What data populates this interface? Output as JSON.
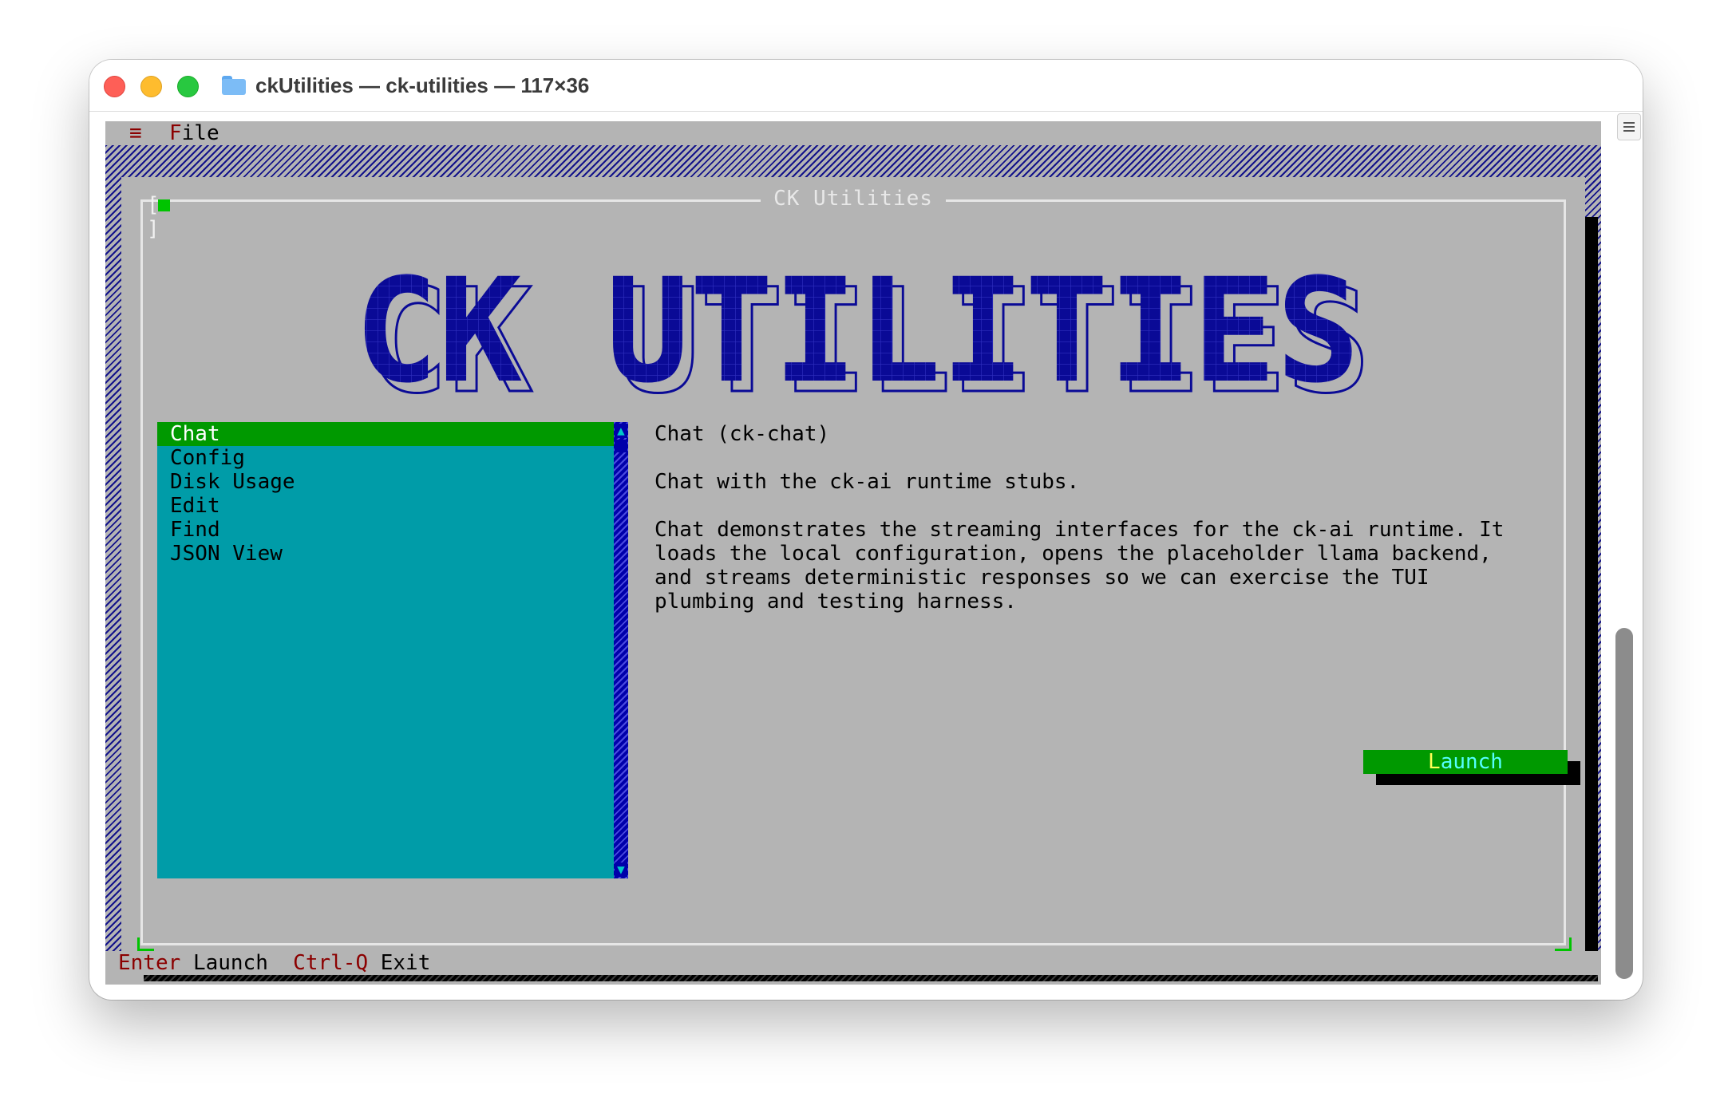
{
  "window": {
    "title": "ckUtilities — ck-utilities — 117×36"
  },
  "menubar": {
    "menu_icon": "≡",
    "file_hotkey": "F",
    "file_rest": "ile"
  },
  "dialog": {
    "title": "CK Utilities",
    "close_box": "[ ]",
    "logo_text": "CK UTILITIES"
  },
  "list": {
    "items": [
      {
        "label": "Chat"
      },
      {
        "label": "Config"
      },
      {
        "label": "Disk Usage"
      },
      {
        "label": "Edit"
      },
      {
        "label": "Find"
      },
      {
        "label": "JSON View"
      }
    ],
    "selected_index": 0,
    "scroll_up": "▲",
    "scroll_down": "▼"
  },
  "info": {
    "heading": "Chat (ck-chat)",
    "summary": "Chat with the ck-ai runtime stubs.",
    "description": "Chat demonstrates the streaming interfaces for the ck-ai runtime. It\nloads the local configuration, opens the placeholder llama backend,\nand streams deterministic responses so we can exercise the TUI\nplumbing and testing harness."
  },
  "launch": {
    "hotkey": "L",
    "rest": "aunch"
  },
  "statusbar": {
    "enter_key": "Enter",
    "enter_label": "Launch",
    "quit_key": "Ctrl-Q",
    "quit_label": "Exit"
  },
  "colors": {
    "desktop": "#b4b4b4",
    "pattern": "#12128a",
    "list_bg": "#009ca8",
    "selected": "#009900",
    "logo": "#0a0a96",
    "hotkey": "#8b0000"
  }
}
